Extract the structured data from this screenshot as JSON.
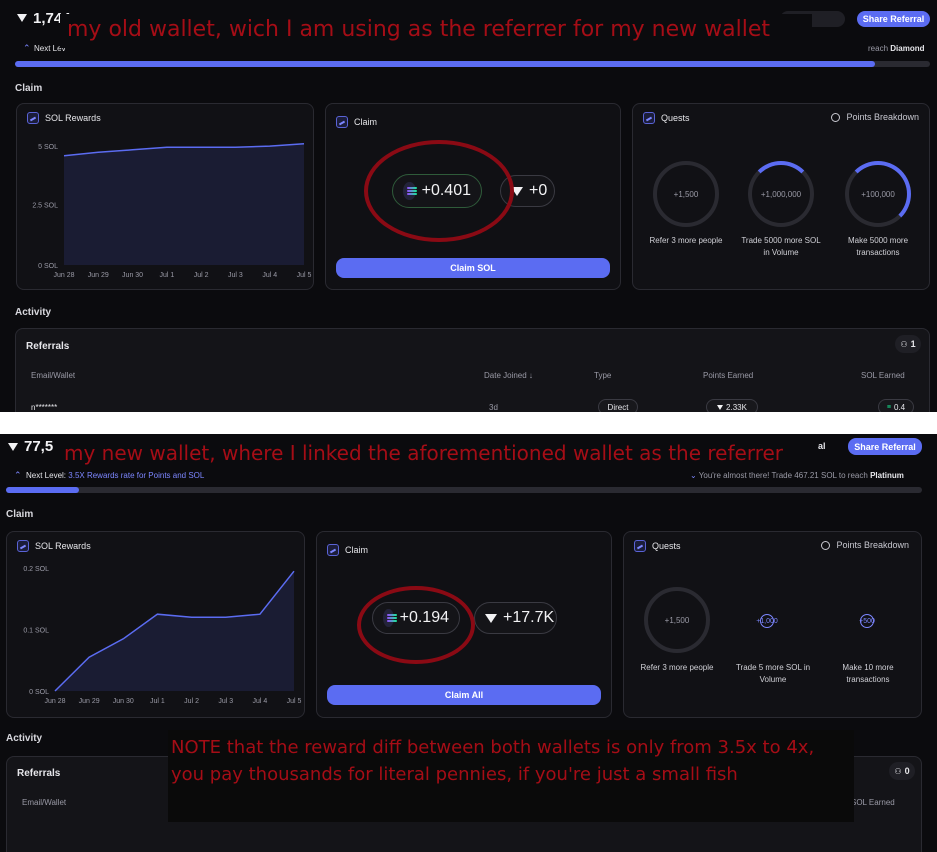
{
  "top": {
    "balance": "1,744,",
    "share_label": "Share Referral",
    "next_level_label": "Next Lev",
    "reach_prefix": "reach",
    "reach_target": "Diamond",
    "progress": 0.94,
    "claim_section": "Claim",
    "rewards_title": "SOL Rewards",
    "y_ticks": [
      "5 SOL",
      "2.5 SOL",
      "0 SOL"
    ],
    "x_ticks": [
      "Jun 28",
      "Jun 29",
      "Jun 30",
      "Jul 1",
      "Jul 2",
      "Jul 3",
      "Jul 4",
      "Jul 5"
    ],
    "claim_title": "Claim",
    "sol_amount": "+0.401",
    "points_amount": "+0",
    "claim_button": "Claim SOL",
    "quests_title": "Quests",
    "breakdown_label": "Points Breakdown",
    "quests": [
      {
        "points": "+1,500",
        "label": "Refer 3 more people",
        "progress": 0
      },
      {
        "points": "+1,000,000",
        "label": "Trade 5000 more SOL in Volume",
        "progress": 0.08
      },
      {
        "points": "+100,000",
        "label": "Make 5000 more transactions",
        "progress": 0.35
      }
    ],
    "activity_label": "Activity",
    "referrals_title": "Referrals",
    "referrals_count": "1",
    "columns": [
      "Email/Wallet",
      "Date Joined ↓",
      "Type",
      "Points Earned",
      "SOL Earned"
    ],
    "row": {
      "wallet": "n*******",
      "date": "3d",
      "type": "Direct",
      "points": "2.33K",
      "sol": "0.4"
    }
  },
  "bottom": {
    "balance": "77,5",
    "share_label": "Share Referral",
    "share_fragment": "al",
    "next_level_label": "Next Level:",
    "next_level_text": "3.5X Rewards rate for Points and SOL",
    "almost_text": "You're almost there! Trade 467.21 SOL to reach",
    "almost_target": "Platinum",
    "progress": 0.08,
    "claim_section": "Claim",
    "rewards_title": "SOL Rewards",
    "y_ticks": [
      "0.2 SOL",
      "0.1 SOL",
      "0 SOL"
    ],
    "x_ticks": [
      "Jun 28",
      "Jun 29",
      "Jun 30",
      "Jul 1",
      "Jul 2",
      "Jul 3",
      "Jul 4",
      "Jul 5"
    ],
    "claim_title": "Claim",
    "sol_amount": "+0.194",
    "points_amount": "+17.7K",
    "claim_button": "Claim All",
    "quests_title": "Quests",
    "breakdown_label": "Points Breakdown",
    "quests": [
      {
        "points": "+1,500",
        "label": "Refer 3 more people"
      },
      {
        "points": "+1,000",
        "label": "Trade 5 more SOL in Volume"
      },
      {
        "points": "+500",
        "label": "Make 10 more transactions"
      }
    ],
    "activity_label": "Activity",
    "referrals_title": "Referrals",
    "referrals_count": "0",
    "col_wallet": "Email/Wallet",
    "col_sol": "SOL Earned"
  },
  "annotations": {
    "top": "my old wallet, wich I am using as the referrer for my new wallet",
    "middle": "my new wallet, where I linked the aforementioned wallet as the  referrer",
    "note": "NOTE that the reward diff between both wallets is only from 3.5x to 4x, you pay thousands for literal pennies, if you're just a small fish"
  },
  "chart_data": [
    {
      "type": "area",
      "x": [
        "Jun 28",
        "Jun 29",
        "Jun 30",
        "Jul 1",
        "Jul 2",
        "Jul 3",
        "Jul 4",
        "Jul 5"
      ],
      "y": [
        4.5,
        4.65,
        4.75,
        4.85,
        4.85,
        4.85,
        4.9,
        5.0
      ],
      "ylim": [
        0,
        5.4
      ],
      "y_unit": "SOL"
    },
    {
      "type": "area",
      "x": [
        "Jun 28",
        "Jun 29",
        "Jun 30",
        "Jul 1",
        "Jul 2",
        "Jul 3",
        "Jul 4",
        "Jul 5"
      ],
      "y": [
        0.0,
        0.055,
        0.085,
        0.125,
        0.12,
        0.12,
        0.125,
        0.195
      ],
      "ylim": [
        0,
        0.21
      ],
      "y_unit": "SOL"
    }
  ],
  "colors": {
    "accent": "#5b6cf2",
    "annotation": "#a50d16"
  }
}
